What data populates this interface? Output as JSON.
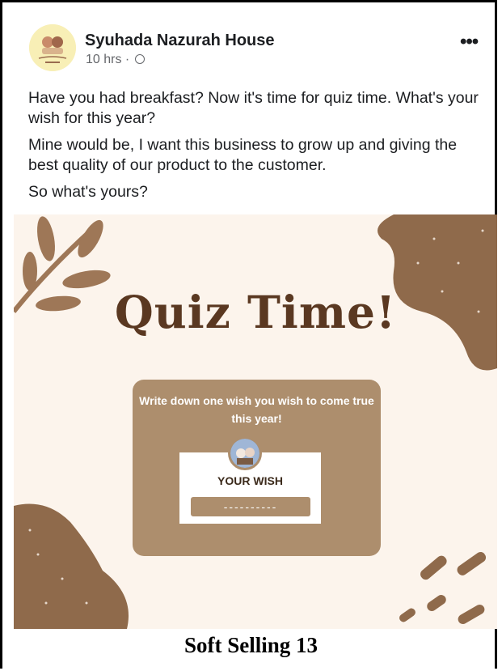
{
  "post": {
    "page_name": "Syuhada Nazurah House",
    "time": "10 hrs · ",
    "more_label": "•••",
    "paragraphs": [
      "Have you had breakfast? Now it's time for quiz time. What's your wish for this year?",
      "Mine would be, I want this business to grow up and giving the best quality of our product to the customer.",
      "So what's yours?"
    ]
  },
  "image": {
    "title": "Quiz Time!",
    "card_text": "Write down one wish you wish to come true this year!",
    "wish_label": "YOUR WISH",
    "wish_line": "----------"
  },
  "caption": "Soft Selling 13",
  "colors": {
    "brown_dark": "#5a3821",
    "brown_mid": "#ad8e6d",
    "blob": "#8f6a4b",
    "background": "#fcf4ec"
  }
}
